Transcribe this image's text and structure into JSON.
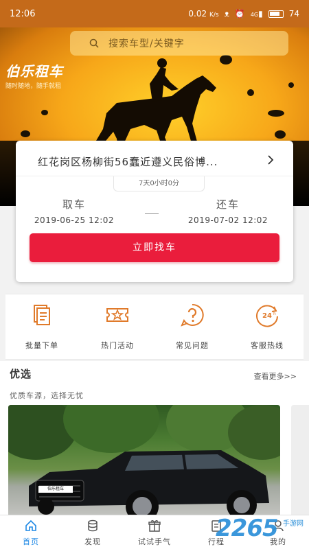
{
  "statusbar": {
    "time": "12:06",
    "speed": "0.02",
    "speed_unit": "K/s",
    "network": "4G",
    "battery": "74"
  },
  "brand": {
    "name": "伯乐租车",
    "slogan": "随时随地，随手就租"
  },
  "search": {
    "placeholder": "搜索车型/关键字"
  },
  "booking": {
    "address": "红花岗区杨柳街56蠢近遵义民俗博...",
    "duration": "7天0小时0分",
    "pickup_label": "取车",
    "pickup_time": "2019-06-25 12:02",
    "return_label": "还车",
    "return_time": "2019-07-02 12:02",
    "find_button": "立即找车"
  },
  "quick_actions": [
    {
      "label": "批量下单",
      "icon": "document-icon"
    },
    {
      "label": "热门活动",
      "icon": "ticket-star-icon"
    },
    {
      "label": "常见问题",
      "icon": "question-icon"
    },
    {
      "label": "客服热线",
      "icon": "24h-service-icon"
    }
  ],
  "featured": {
    "title": "优选",
    "more": "查看更多>>",
    "subtitle": "优质车源，选择无忧",
    "plate_text": "伯乐租车"
  },
  "tabs": [
    {
      "label": "首页",
      "icon": "home-icon",
      "active": true
    },
    {
      "label": "发现",
      "icon": "discover-icon",
      "active": false
    },
    {
      "label": "试试手气",
      "icon": "gift-icon",
      "active": false
    },
    {
      "label": "行程",
      "icon": "trip-icon",
      "active": false
    },
    {
      "label": "我的",
      "icon": "profile-icon",
      "active": false
    }
  ],
  "watermark": {
    "number": "2265",
    "site": "手游网"
  },
  "colors": {
    "accent_red": "#ea1d3c",
    "accent_orange": "#e07a2a",
    "tab_active": "#1e88e5"
  }
}
